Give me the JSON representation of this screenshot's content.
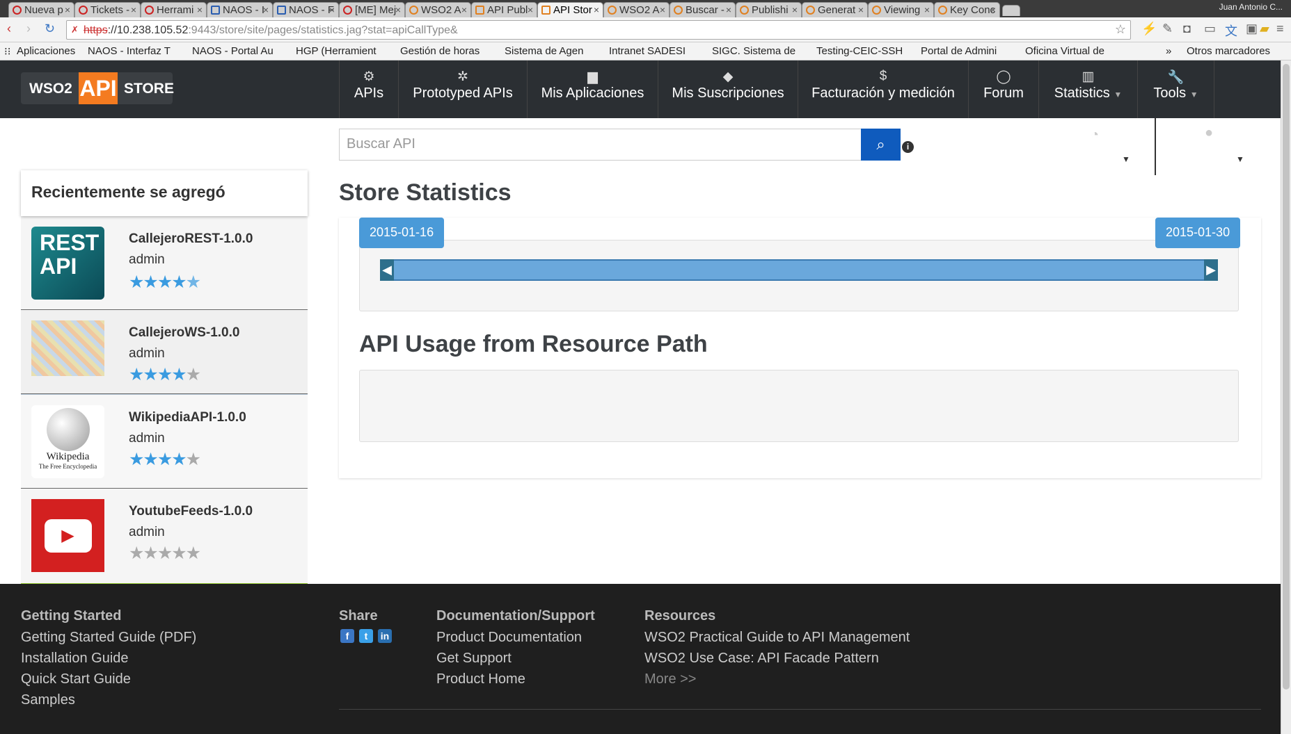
{
  "browser": {
    "tabs": [
      {
        "label": "Nueva p",
        "active": false
      },
      {
        "label": "Tickets -",
        "active": false
      },
      {
        "label": "Herrami",
        "active": false
      },
      {
        "label": "NAOS - I",
        "active": false
      },
      {
        "label": "NAOS - F",
        "active": false
      },
      {
        "label": "[ME] Mej",
        "active": false
      },
      {
        "label": "WSO2 A",
        "active": false
      },
      {
        "label": "API Publ",
        "active": false
      },
      {
        "label": "API Stor",
        "active": true
      },
      {
        "label": "WSO2 A",
        "active": false
      },
      {
        "label": "Buscar -",
        "active": false
      },
      {
        "label": "Publishi",
        "active": false
      },
      {
        "label": "Generat",
        "active": false
      },
      {
        "label": "Viewing",
        "active": false
      },
      {
        "label": "Key Conc",
        "active": false
      }
    ],
    "user": "Juan Antonio C...",
    "url_scheme": "https",
    "url_host": "://10.238.105.52",
    "url_rest": ":9443/store/site/pages/statistics.jag?stat=apiCallType&",
    "bookmarks": [
      "Aplicaciones",
      "NAOS - Interfaz T",
      "NAOS - Portal Au",
      "HGP (Herramient",
      "Gestión de horas",
      "Sistema de Agen",
      "Intranet SADESI",
      "SIGC. Sistema de",
      "Testing-CEIC-SSH",
      "Portal de Admini",
      "Oficina Virtual de"
    ],
    "bookmarks_more": "»",
    "other_bookmarks": "Otros marcadores"
  },
  "header": {
    "logo_left": "WSO2",
    "logo_api": "API",
    "logo_right": "STORE",
    "nav": [
      {
        "label": "APIs",
        "icon": "gears-icon"
      },
      {
        "label": "Prototyped APIs",
        "icon": "gear-icon"
      },
      {
        "label": "Mis Aplicaciones",
        "icon": "briefcase-icon"
      },
      {
        "label": "Mis Suscripciones",
        "icon": "tags-icon"
      },
      {
        "label": "Facturación y medición",
        "icon": "dollar-icon"
      },
      {
        "label": "Forum",
        "icon": "comment-icon"
      },
      {
        "label": "Statistics",
        "icon": "chart-icon"
      },
      {
        "label": "Tools",
        "icon": "wrench-icon"
      }
    ]
  },
  "search": {
    "placeholder": "Buscar API"
  },
  "sidebar": {
    "title": "Recientemente se agregó",
    "items": [
      {
        "name": "CallejeroREST-1.0.0",
        "owner": "admin",
        "rating": 4.5,
        "thumb_text": "REST API"
      },
      {
        "name": "CallejeroWS-1.0.0",
        "owner": "admin",
        "rating": 4,
        "thumb_text": ""
      },
      {
        "name": "WikipediaAPI-1.0.0",
        "owner": "admin",
        "rating": 4,
        "thumb_text": "Wikipedia",
        "thumb_sub": "The Free Encyclopedia"
      },
      {
        "name": "YoutubeFeeds-1.0.0",
        "owner": "admin",
        "rating": 0,
        "thumb_text": ""
      }
    ]
  },
  "main": {
    "title": "Store Statistics",
    "date_from": "2015-01-16",
    "date_to": "2015-01-30",
    "usage_title": "API Usage from Resource Path"
  },
  "footer": {
    "getting_started": {
      "title": "Getting Started",
      "links": [
        "Getting Started Guide (PDF)",
        "Installation Guide",
        "Quick Start Guide",
        "Samples"
      ]
    },
    "share": {
      "title": "Share"
    },
    "docs": {
      "title": "Documentation/Support",
      "links": [
        "Product Documentation",
        "Get Support",
        "Product Home"
      ]
    },
    "resources": {
      "title": "Resources",
      "links": [
        "WSO2 Practical Guide to API Management",
        "WSO2 Use Case: API Facade Pattern"
      ],
      "more": "More >>"
    }
  }
}
